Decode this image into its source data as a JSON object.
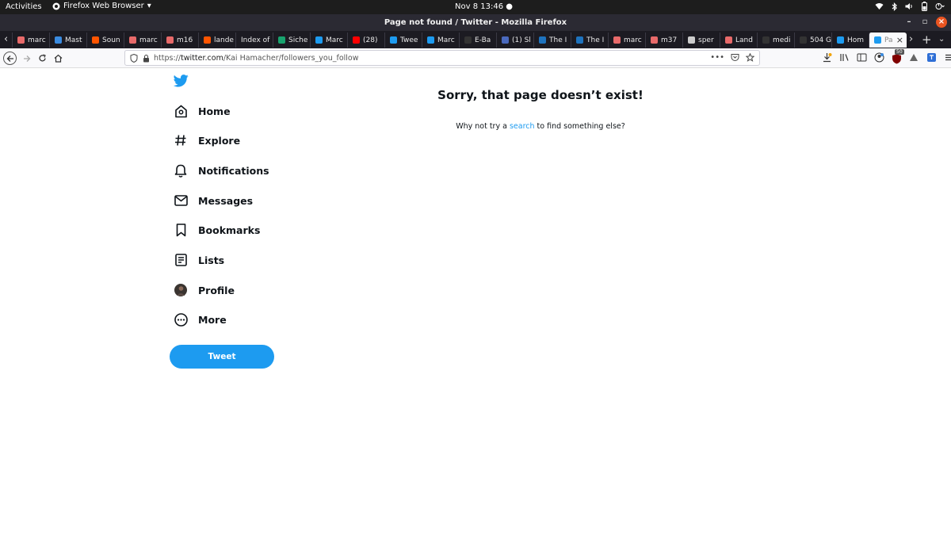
{
  "system_bar": {
    "activities": "Activities",
    "app_menu": "Firefox Web Browser",
    "clock": "Nov 8  13:46"
  },
  "window": {
    "title": "Page not found / Twitter - Mozilla Firefox"
  },
  "tabs": [
    {
      "label": "marc",
      "color": "#e86a6a"
    },
    {
      "label": "Mast",
      "color": "#3a8be0"
    },
    {
      "label": "Soun",
      "color": "#ff5500"
    },
    {
      "label": "marc",
      "color": "#e86a6a"
    },
    {
      "label": "m16",
      "color": "#e86a6a"
    },
    {
      "label": "lande",
      "color": "#ff5500"
    },
    {
      "label": "Index of",
      "color": ""
    },
    {
      "label": "Siche",
      "color": "#18a36e"
    },
    {
      "label": "Marc",
      "color": "#1d9bf0"
    },
    {
      "label": "(28)",
      "color": "#ff0000"
    },
    {
      "label": "Twee",
      "color": "#1d9bf0"
    },
    {
      "label": "Marc",
      "color": "#1d9bf0"
    },
    {
      "label": "E-Ba",
      "color": "#333333"
    },
    {
      "label": "(1) Sl",
      "color": "#4a69bd"
    },
    {
      "label": "The I",
      "color": "#1e73be"
    },
    {
      "label": "The I",
      "color": "#1e73be"
    },
    {
      "label": "marc",
      "color": "#e86a6a"
    },
    {
      "label": "m37",
      "color": "#e86a6a"
    },
    {
      "label": "sper",
      "color": "#cccccc"
    },
    {
      "label": "Land",
      "color": "#e86a6a"
    },
    {
      "label": "medi",
      "color": "#333333"
    },
    {
      "label": "504 G",
      "color": "#333333"
    },
    {
      "label": "Hom",
      "color": "#1d9bf0"
    },
    {
      "label": "Pa",
      "color": "#1d9bf0"
    }
  ],
  "address_bar": {
    "url_prefix": "https://",
    "url_host": "twitter.com",
    "url_path": "/Kai Hamacher/followers_you_follow",
    "addons_badge": "50"
  },
  "sidebar": {
    "items": [
      {
        "label": "Home",
        "icon": "home-icon"
      },
      {
        "label": "Explore",
        "icon": "hashtag-icon"
      },
      {
        "label": "Notifications",
        "icon": "bell-icon"
      },
      {
        "label": "Messages",
        "icon": "envelope-icon"
      },
      {
        "label": "Bookmarks",
        "icon": "bookmark-icon"
      },
      {
        "label": "Lists",
        "icon": "list-icon"
      },
      {
        "label": "Profile",
        "icon": "avatar-icon"
      },
      {
        "label": "More",
        "icon": "more-icon"
      }
    ],
    "tweet_button": "Tweet"
  },
  "main": {
    "heading": "Sorry, that page doesn’t exist!",
    "message_before": "Why not try a ",
    "message_link": "search",
    "message_after": " to find something else?"
  },
  "colors": {
    "twitter_blue": "#1d9bf0",
    "ubuntu_orange": "#e95420"
  }
}
